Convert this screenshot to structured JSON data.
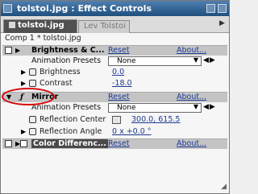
{
  "window": {
    "title": "tolstoi.jpg : Effect Controls",
    "tabs": [
      {
        "label": "tolstoi.jpg",
        "active": true
      },
      {
        "label": "Lev Tolstoi",
        "active": false
      }
    ],
    "comp_label": "Comp 1 * tolstoi.jpg"
  },
  "effects": [
    {
      "name": "Brightness & C...",
      "reset": "Reset",
      "about": "About...",
      "presets_label": "Animation Presets",
      "preset_value": "None",
      "properties": [
        {
          "label": "Brightness",
          "value": "0.0"
        },
        {
          "label": "Contrast",
          "value": "-18.0"
        }
      ]
    },
    {
      "name": "Mirror",
      "reset": "Reset",
      "about": "About...",
      "presets_label": "Animation Presets",
      "preset_value": "None",
      "properties": [
        {
          "label": "Reflection Center",
          "value": "300.0, 615.5"
        },
        {
          "label": "Reflection Angle",
          "value": "0 x +0.0 °"
        }
      ]
    },
    {
      "name": "Color Differenc...",
      "reset": "Reset",
      "about": "About..."
    }
  ],
  "colors": {
    "title_bar": "#2f5f8e",
    "link": "#1c3a94",
    "highlight_circle": "#d80000"
  },
  "icons": [
    "close-icon",
    "expand-triangle-icon",
    "fx-icon",
    "stopwatch-icon",
    "dropdown-arrow-icon",
    "crosshair-icon",
    "resize-grip-icon"
  ]
}
